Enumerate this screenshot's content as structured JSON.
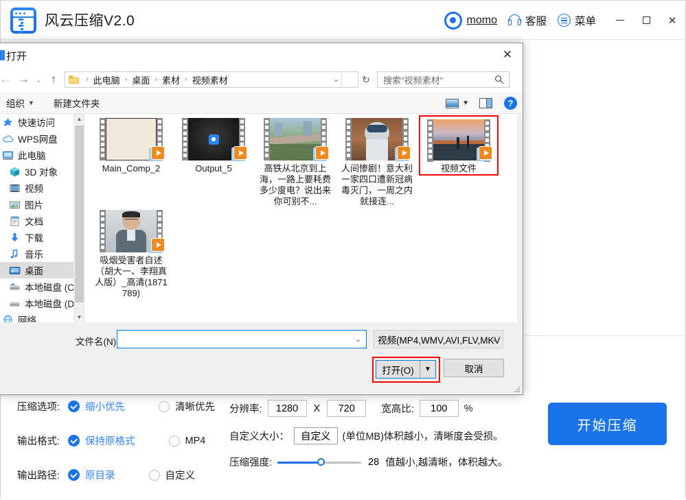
{
  "app": {
    "title": "风云压缩V2.0",
    "logo_icon": "zip-app-icon",
    "user": {
      "name": "momo",
      "icon": "user-target-icon"
    },
    "support": {
      "label": "客服",
      "icon": "headset-icon"
    },
    "menu": {
      "label": "菜单",
      "icon": "menu-list-icon"
    },
    "window_controls": {
      "minimize": "minimize-icon",
      "maximize": "maximize-icon",
      "close": "✕"
    }
  },
  "options": {
    "rows": [
      {
        "label": "压缩选项:",
        "selected_text": "缩小优先",
        "unselected_text": "清晰优先"
      },
      {
        "label": "输出格式:",
        "selected_text": "保持原格式",
        "unselected_text": "MP4"
      },
      {
        "label": "输出路径:",
        "selected_text": "原目录",
        "unselected_text": "自定义"
      }
    ],
    "resolution": {
      "label": "分辨率:",
      "width": "1280",
      "x": "X",
      "height": "720",
      "ratio_label": "宽高比:",
      "ratio_value": "100",
      "percent": "%"
    },
    "custom_size": {
      "label": "自定义大小：",
      "button": "自定义",
      "hint": "(单位MB)体积越小，清晰度会受损。"
    },
    "strength": {
      "label": "压缩强度:",
      "value": "28",
      "hint": "值越小,越清晰，体积越大。"
    },
    "start_button": "开始压缩"
  },
  "dialog": {
    "title": "打开",
    "close": "✕",
    "nav": {
      "back": "←",
      "forward": "→",
      "history": "⌄",
      "up": "↑",
      "breadcrumbs": [
        "此电脑",
        "桌面",
        "素材",
        "视频素材"
      ],
      "dropdown": "⌄",
      "refresh": "↻",
      "search_placeholder": "搜索\"视频素材\""
    },
    "toolbar": {
      "organize": "组织",
      "new_folder": "新建文件夹",
      "view_icon": "view-layout-icon",
      "pane_icon": "preview-pane-icon",
      "help_icon": "help-icon",
      "help_label": "?"
    },
    "sidebar": [
      {
        "label": "快速访问",
        "icon": "quick-access-star-icon",
        "indent": false,
        "selected": false
      },
      {
        "label": "WPS网盘",
        "icon": "cloud-icon",
        "indent": false,
        "selected": false
      },
      {
        "label": "此电脑",
        "icon": "this-pc-icon",
        "indent": false,
        "selected": false
      },
      {
        "label": "3D 对象",
        "icon": "3d-objects-icon",
        "indent": true,
        "selected": false
      },
      {
        "label": "视频",
        "icon": "videos-icon",
        "indent": true,
        "selected": false
      },
      {
        "label": "图片",
        "icon": "pictures-icon",
        "indent": true,
        "selected": false
      },
      {
        "label": "文档",
        "icon": "documents-icon",
        "indent": true,
        "selected": false
      },
      {
        "label": "下载",
        "icon": "downloads-icon",
        "indent": true,
        "selected": false
      },
      {
        "label": "音乐",
        "icon": "music-icon",
        "indent": true,
        "selected": false
      },
      {
        "label": "桌面",
        "icon": "desktop-icon",
        "indent": true,
        "selected": true
      },
      {
        "label": "本地磁盘 (C:)",
        "icon": "local-disk-c-icon",
        "indent": true,
        "selected": false
      },
      {
        "label": "本地磁盘 (D:)",
        "icon": "local-disk-d-icon",
        "indent": true,
        "selected": false
      },
      {
        "label": "网络",
        "icon": "network-icon",
        "indent": false,
        "selected": false
      }
    ],
    "files": [
      {
        "name": "Main_Comp_2",
        "selected": false,
        "thumb": "blank-cream"
      },
      {
        "name": "Output_5",
        "selected": false,
        "thumb": "logo-dark"
      },
      {
        "name": "高铁从北京到上海，一路上要耗费多少度电？说出来你可别不...",
        "selected": false,
        "thumb": "railway"
      },
      {
        "name": "人间惨剧！意大利一家四口遭新冠病毒灭门，一周之内就接连...",
        "selected": false,
        "thumb": "person-mask"
      },
      {
        "name": "视频文件",
        "selected": true,
        "thumb": "sunset-bridge"
      },
      {
        "name": "吸烟受害者自述（胡大一、李翔真人版）_高清(1871789)",
        "selected": false,
        "thumb": "man-interview"
      }
    ],
    "bottom": {
      "filename_label": "文件名(N):",
      "filename_value": "",
      "filetype_value": "视频(MP4,WMV,AVI,FLV,MKV",
      "open_button": "打开(O)",
      "open_dropdown": "▼",
      "cancel_button": "取消"
    }
  },
  "colors": {
    "accent": "#1a73e8",
    "selection_red": "#ff0000",
    "link_blue": "#2f86f6"
  }
}
